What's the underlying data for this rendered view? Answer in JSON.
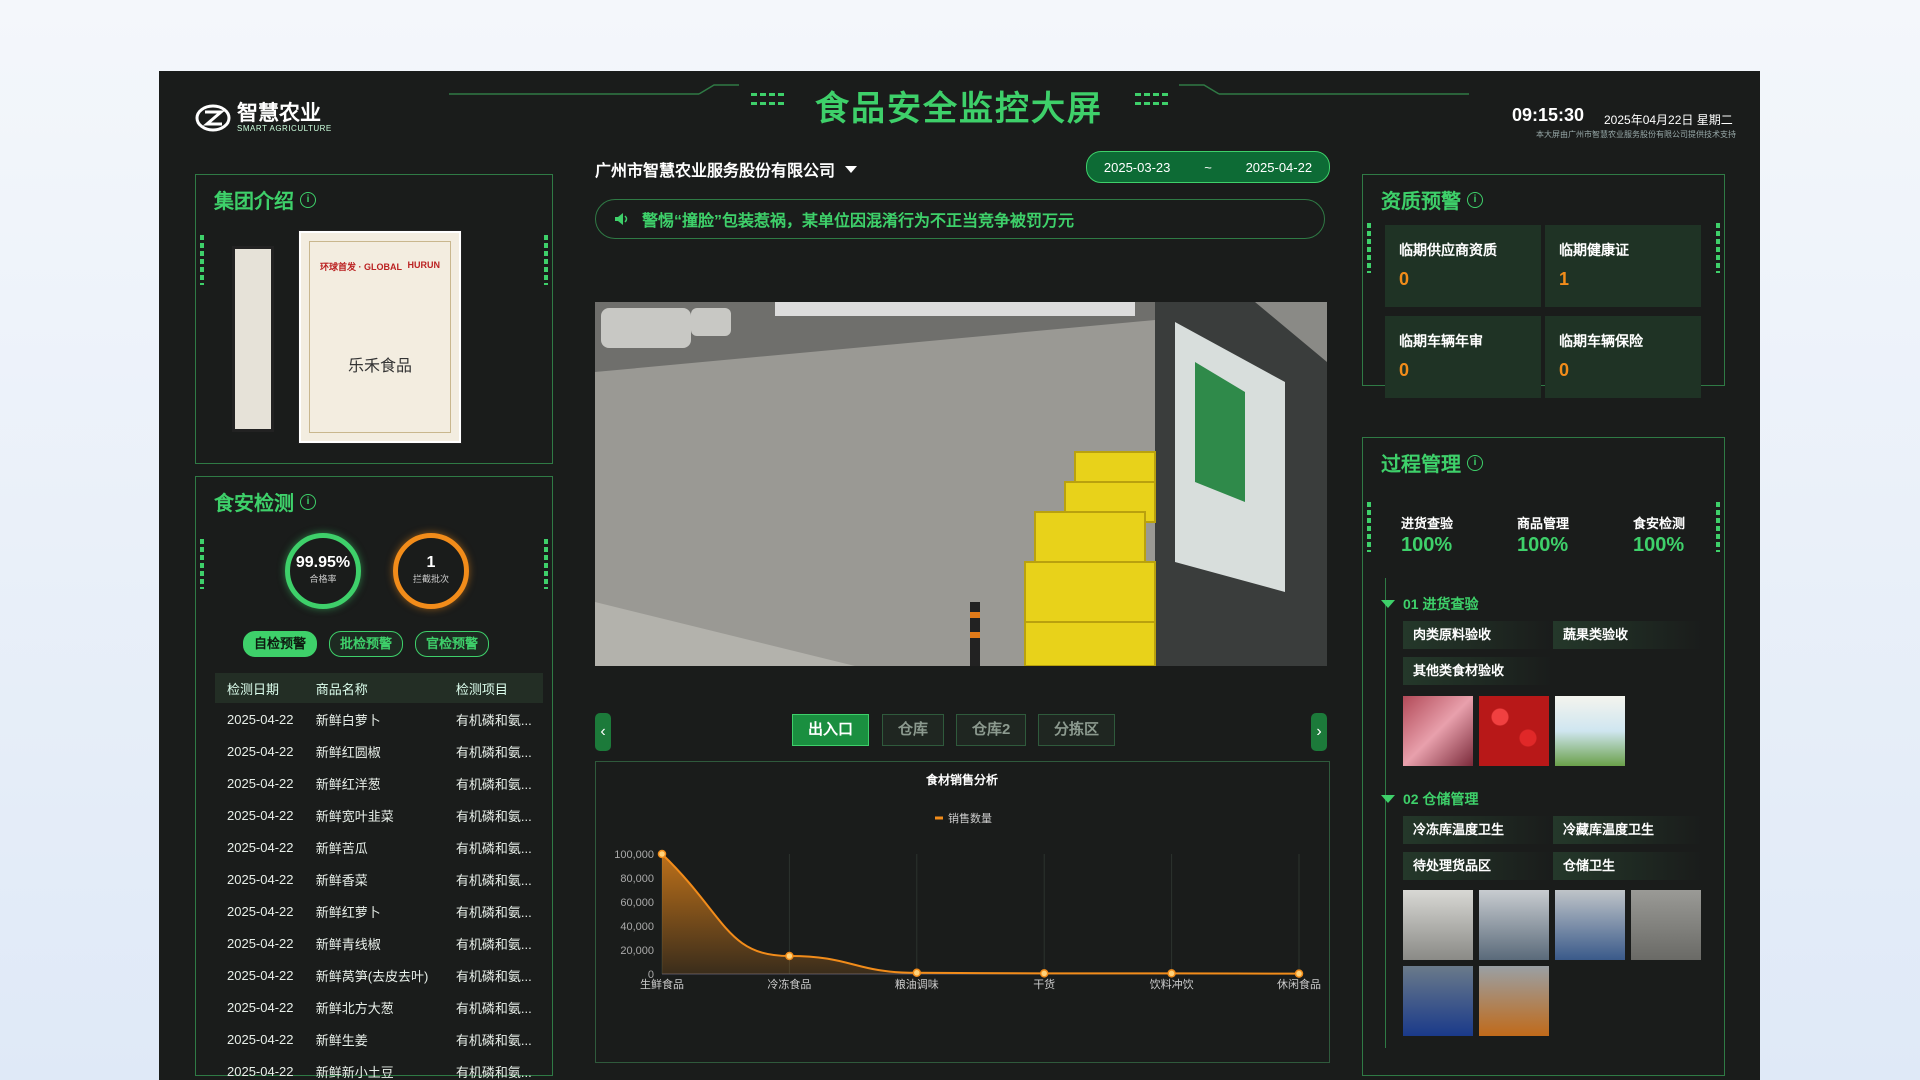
{
  "header": {
    "brand_cn": "智慧农业",
    "brand_en": "SMART AGRICULTURE",
    "title": "食品安全监控大屏",
    "time": "09:15:30",
    "date": "2025年04月22日 星期二",
    "support": "本大屏由广州市智慧农业服务股份有限公司提供技术支持"
  },
  "group_intro": {
    "title": "集团介绍",
    "cert_header": "环球首发 · GLOBAL",
    "cert_brand": "HURUN",
    "cert_name": "乐禾食品"
  },
  "food_detection": {
    "title": "食安检测",
    "pass_rate": {
      "value": "99.95%",
      "label": "合格率"
    },
    "intercepted": {
      "value": "1",
      "label": "拦截批次"
    },
    "tags": [
      "自检预警",
      "批检预警",
      "官检预警"
    ],
    "columns": [
      "检测日期",
      "商品名称",
      "检测项目"
    ],
    "rows": [
      [
        "2025-04-22",
        "新鲜白萝卜",
        "有机磷和氨..."
      ],
      [
        "2025-04-22",
        "新鲜红圆椒",
        "有机磷和氨..."
      ],
      [
        "2025-04-22",
        "新鲜红洋葱",
        "有机磷和氨..."
      ],
      [
        "2025-04-22",
        "新鲜宽叶韭菜",
        "有机磷和氨..."
      ],
      [
        "2025-04-22",
        "新鲜苦瓜",
        "有机磷和氨..."
      ],
      [
        "2025-04-22",
        "新鲜香菜",
        "有机磷和氨..."
      ],
      [
        "2025-04-22",
        "新鲜红萝卜",
        "有机磷和氨..."
      ],
      [
        "2025-04-22",
        "新鲜青线椒",
        "有机磷和氨..."
      ],
      [
        "2025-04-22",
        "新鲜莴笋(去皮去叶)",
        "有机磷和氨..."
      ],
      [
        "2025-04-22",
        "新鲜北方大葱",
        "有机磷和氨..."
      ],
      [
        "2025-04-22",
        "新鲜生姜",
        "有机磷和氨..."
      ],
      [
        "2025-04-22",
        "新鲜新小土豆",
        "有机磷和氨..."
      ]
    ]
  },
  "center": {
    "company": "广州市智慧农业服务股份有限公司",
    "date_start": "2025-03-23",
    "date_sep": "~",
    "date_end": "2025-04-22",
    "notice": "警惕“撞脸”包装惹祸，某单位因混淆行为不正当竞争被罚万元",
    "video_label": "出入口",
    "tabs": [
      "出入口",
      "仓库",
      "仓库2",
      "分拣区"
    ],
    "arrow_left": "‹",
    "arrow_right": "›"
  },
  "chart_data": {
    "type": "area",
    "title": "食材销售分析",
    "series": [
      {
        "name": "销售数量",
        "values": [
          100000,
          15000,
          1000,
          500,
          500,
          300
        ]
      }
    ],
    "categories": [
      "生鲜食品",
      "冷冻食品",
      "粮油调味",
      "干货",
      "饮料冲饮",
      "休闲食品"
    ],
    "yticks": [
      "100,000",
      "80,000",
      "60,000",
      "40,000",
      "20,000",
      "0"
    ],
    "ylim": [
      0,
      100000
    ],
    "color": "#f28c1a"
  },
  "qualification": {
    "title": "资质预警",
    "cards": [
      {
        "label": "临期供应商资质",
        "value": "0"
      },
      {
        "label": "临期健康证",
        "value": "1"
      },
      {
        "label": "临期车辆年审",
        "value": "0"
      },
      {
        "label": "临期车辆保险",
        "value": "0"
      }
    ]
  },
  "process": {
    "title": "过程管理",
    "stats": [
      {
        "label": "进货查验",
        "value": "100%"
      },
      {
        "label": "商品管理",
        "value": "100%"
      },
      {
        "label": "食安检测",
        "value": "100%"
      }
    ],
    "step1": {
      "title": "01 进货查验",
      "chips": [
        "肉类原料验收",
        "蔬果类验收",
        "其他类食材验收"
      ]
    },
    "step2": {
      "title": "02 仓储管理",
      "chips": [
        "冷冻库温度卫生",
        "冷藏库温度卫生",
        "待处理货品区",
        "仓储卫生"
      ]
    }
  }
}
